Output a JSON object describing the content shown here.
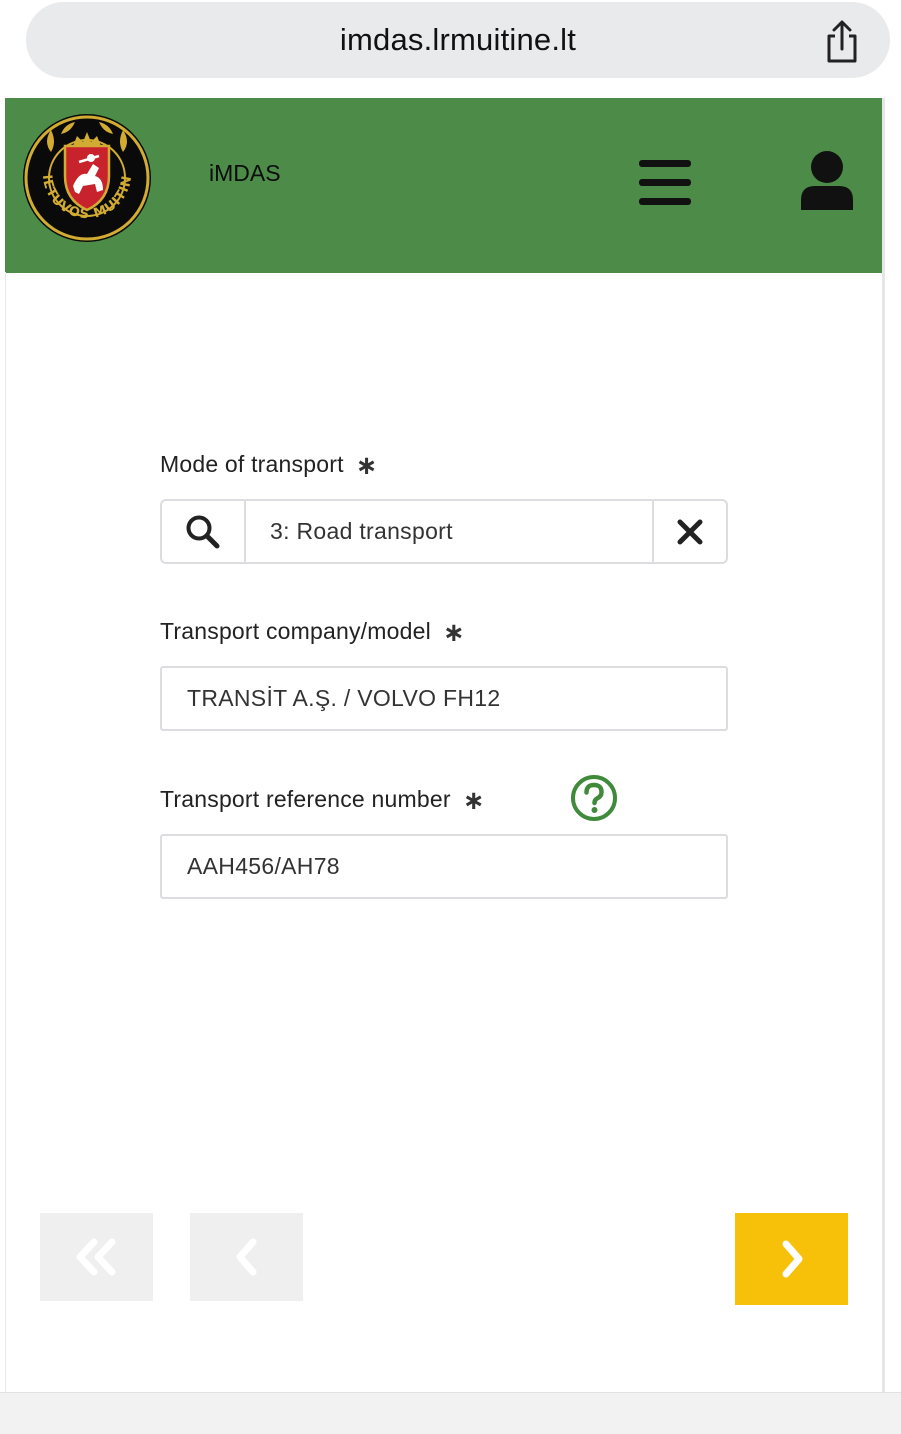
{
  "browser": {
    "url": "imdas.lrmuitine.lt"
  },
  "header": {
    "app_title": "iMDAS",
    "logo_text": "LIETUVOS MUITINĖ",
    "brand_color": "#4c8c48"
  },
  "form": {
    "mode_of_transport": {
      "label": "Mode of transport",
      "required_mark": "∗",
      "value": "3: Road transport"
    },
    "transport_company": {
      "label": "Transport company/model",
      "required_mark": "∗",
      "value": "TRANSİT A.Ş. / VOLVO FH12"
    },
    "transport_reference": {
      "label": "Transport reference number",
      "required_mark": "∗",
      "value": "AAH456/AH78"
    }
  },
  "icons": {
    "share": "share-icon",
    "menu": "hamburger-menu-icon",
    "user": "user-icon",
    "search": "search-icon",
    "clear": "close-icon",
    "help": "question-circle-icon",
    "first": "double-chevron-left-icon",
    "prev": "chevron-left-icon",
    "next": "chevron-right-icon"
  },
  "colors": {
    "accent_next": "#f7c10a",
    "help_green": "#3f8a3b",
    "disabled_button": "#efefef"
  }
}
